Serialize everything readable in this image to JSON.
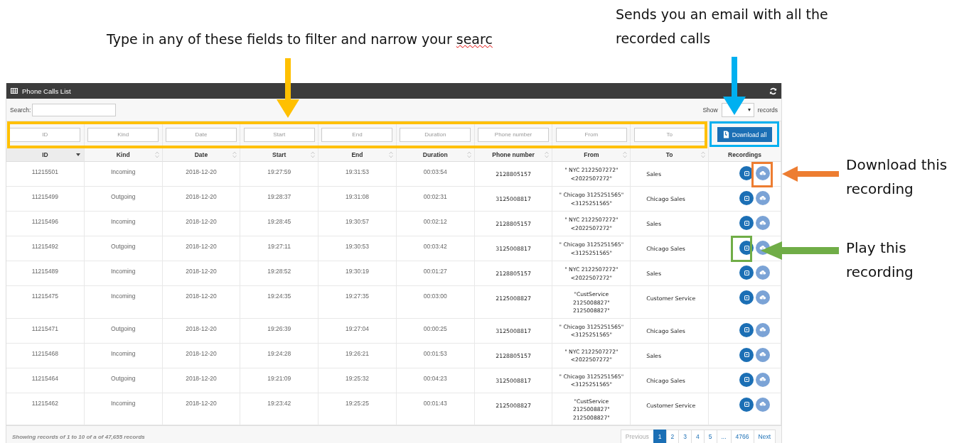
{
  "annotations": [
    {
      "text": "Type in any of these fields to filter and narrow your ",
      "misspelled": "searc"
    },
    {
      "text": "Sends you an email with all the recorded calls"
    },
    {
      "text": "Download this recording"
    },
    {
      "text": "Play this recording"
    }
  ],
  "panel": {
    "title": "Phone Calls List",
    "search_label": "Search:",
    "show_label": "Show",
    "records_label": "records",
    "download_all": "Download all"
  },
  "filters": [
    {
      "placeholder": "ID"
    },
    {
      "placeholder": "Kind"
    },
    {
      "placeholder": "Date"
    },
    {
      "placeholder": "Start"
    },
    {
      "placeholder": "End"
    },
    {
      "placeholder": "Duration"
    },
    {
      "placeholder": "Phone number"
    },
    {
      "placeholder": "From"
    },
    {
      "placeholder": "To"
    }
  ],
  "columns": [
    {
      "label": "ID",
      "sortable": true,
      "sorted": true
    },
    {
      "label": "Kind",
      "sortable": true,
      "sorted": false
    },
    {
      "label": "Date",
      "sortable": true,
      "sorted": false
    },
    {
      "label": "Start",
      "sortable": true,
      "sorted": false
    },
    {
      "label": "End",
      "sortable": true,
      "sorted": false
    },
    {
      "label": "Duration",
      "sortable": true,
      "sorted": false
    },
    {
      "label": "Phone number",
      "sortable": true,
      "sorted": false
    },
    {
      "label": "From",
      "sortable": true,
      "sorted": false
    },
    {
      "label": "To",
      "sortable": true,
      "sorted": false
    },
    {
      "label": "Recordings",
      "sortable": false
    }
  ],
  "rows": [
    {
      "id": "11215501",
      "kind": "Incoming",
      "date": "2018-12-20",
      "start": "19:27:59",
      "end": "19:31:53",
      "duration": "00:03:54",
      "phone": "2128805157",
      "from": [
        "\" NYC 2122507272\"",
        "<2022507272\""
      ],
      "to": "Sales"
    },
    {
      "id": "11215499",
      "kind": "Outgoing",
      "date": "2018-12-20",
      "start": "19:28:37",
      "end": "19:31:08",
      "duration": "00:02:31",
      "phone": "3125008817",
      "from": [
        "\" Chicago 3125251565\"",
        "<3125251565\""
      ],
      "to": "Chicago Sales"
    },
    {
      "id": "11215496",
      "kind": "Incoming",
      "date": "2018-12-20",
      "start": "19:28:45",
      "end": "19:30:57",
      "duration": "00:02:12",
      "phone": "2128805157",
      "from": [
        "\" NYC 2122507272\"",
        "<2022507272\""
      ],
      "to": "Sales"
    },
    {
      "id": "11215492",
      "kind": "Outgoing",
      "date": "2018-12-20",
      "start": "19:27:11",
      "end": "19:30:53",
      "duration": "00:03:42",
      "phone": "3125008817",
      "from": [
        "\" Chicago 3125251565\"",
        "<3125251565\""
      ],
      "to": "Chicago Sales"
    },
    {
      "id": "11215489",
      "kind": "Incoming",
      "date": "2018-12-20",
      "start": "19:28:52",
      "end": "19:30:19",
      "duration": "00:01:27",
      "phone": "2128805157",
      "from": [
        "\" NYC 2122507272\"",
        "<2022507272\""
      ],
      "to": "Sales"
    },
    {
      "id": "11215475",
      "kind": "Incoming",
      "date": "2018-12-20",
      "start": "19:24:35",
      "end": "19:27:35",
      "duration": "00:03:00",
      "phone": "2125008827",
      "from": [
        "\"CustService",
        "2125008827\"",
        "2125008827\""
      ],
      "to": "Customer Service"
    },
    {
      "id": "11215471",
      "kind": "Outgoing",
      "date": "2018-12-20",
      "start": "19:26:39",
      "end": "19:27:04",
      "duration": "00:00:25",
      "phone": "3125008817",
      "from": [
        "\" Chicago 3125251565\"",
        "<3125251565\""
      ],
      "to": "Chicago Sales"
    },
    {
      "id": "11215468",
      "kind": "Incoming",
      "date": "2018-12-20",
      "start": "19:24:28",
      "end": "19:26:21",
      "duration": "00:01:53",
      "phone": "2128805157",
      "from": [
        "\" NYC 2122507272\"",
        "<2022507272\""
      ],
      "to": "Sales"
    },
    {
      "id": "11215464",
      "kind": "Outgoing",
      "date": "2018-12-20",
      "start": "19:21:09",
      "end": "19:25:32",
      "duration": "00:04:23",
      "phone": "3125008817",
      "from": [
        "\" Chicago 3125251565\"",
        "<3125251565\""
      ],
      "to": "Chicago Sales"
    },
    {
      "id": "11215462",
      "kind": "Incoming",
      "date": "2018-12-20",
      "start": "19:23:42",
      "end": "19:25:25",
      "duration": "00:01:43",
      "phone": "2125008827",
      "from": [
        "\"CustService",
        "2125008827\"",
        "2125008827\""
      ],
      "to": "Customer Service"
    }
  ],
  "footer": {
    "summary": "Showing records of 1 to 10 of a of 47,655 records"
  },
  "pagination": {
    "previous": {
      "label": "Previous",
      "disabled": true
    },
    "pages": [
      {
        "label": "1",
        "selected": true
      },
      {
        "label": "2",
        "selected": false
      },
      {
        "label": "3",
        "selected": false
      },
      {
        "label": "4",
        "selected": false
      },
      {
        "label": "5",
        "selected": false
      },
      {
        "label": "...",
        "selected": false
      },
      {
        "label": "4766",
        "selected": false
      }
    ],
    "next": {
      "label": "Next",
      "disabled": false
    }
  }
}
